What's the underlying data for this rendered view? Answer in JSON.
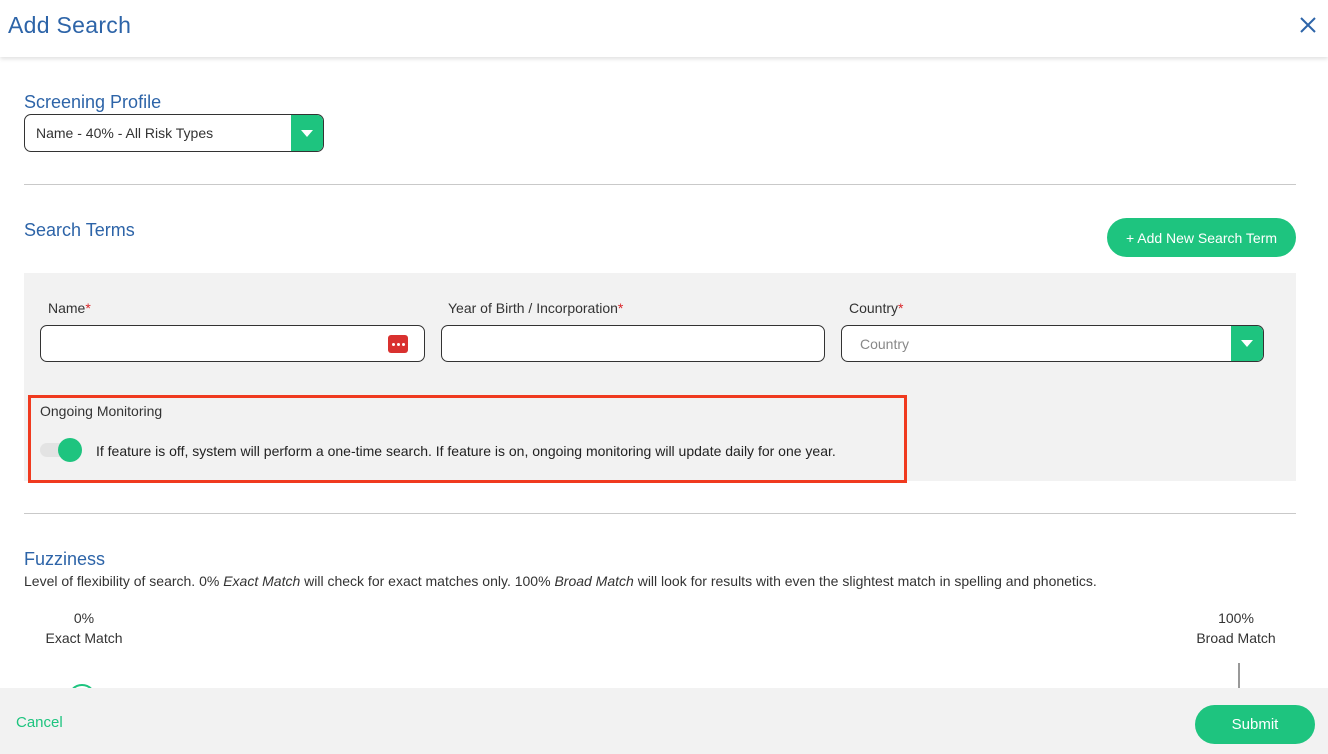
{
  "header": {
    "title": "Add  Search"
  },
  "screening_profile": {
    "heading": "Screening Profile",
    "selected": "Name - 40% - All Risk Types"
  },
  "search_terms": {
    "heading": "Search Terms",
    "add_button": "+ Add New Search Term",
    "name_label": "Name",
    "yob_label": "Year of Birth / Incorporation",
    "country_label": "Country",
    "required_mark": "*",
    "name_value": "",
    "yob_value": "",
    "country_placeholder": "Country"
  },
  "monitoring": {
    "label": "Ongoing Monitoring",
    "enabled": true,
    "description": "If feature is off, system will perform a one-time search. If feature is on, ongoing monitoring will update daily for one year."
  },
  "fuzziness": {
    "heading": "Fuzziness",
    "desc_1": "Level of flexibility of search. 0% ",
    "desc_exact": "Exact Match",
    "desc_2": " will check for exact matches only. 100% ",
    "desc_broad": "Broad Match",
    "desc_3": " will look for results with even the slightest match in spelling and phonetics.",
    "min_pct": "0%",
    "min_label": "Exact Match",
    "max_pct": "100%",
    "max_label": "Broad Match",
    "value_pct": 0
  },
  "footer": {
    "cancel": "Cancel",
    "submit": "Submit"
  },
  "colors": {
    "accent": "#1ec47f",
    "heading": "#2d64a8",
    "highlight": "#f03a1f",
    "required": "#d9262a"
  }
}
